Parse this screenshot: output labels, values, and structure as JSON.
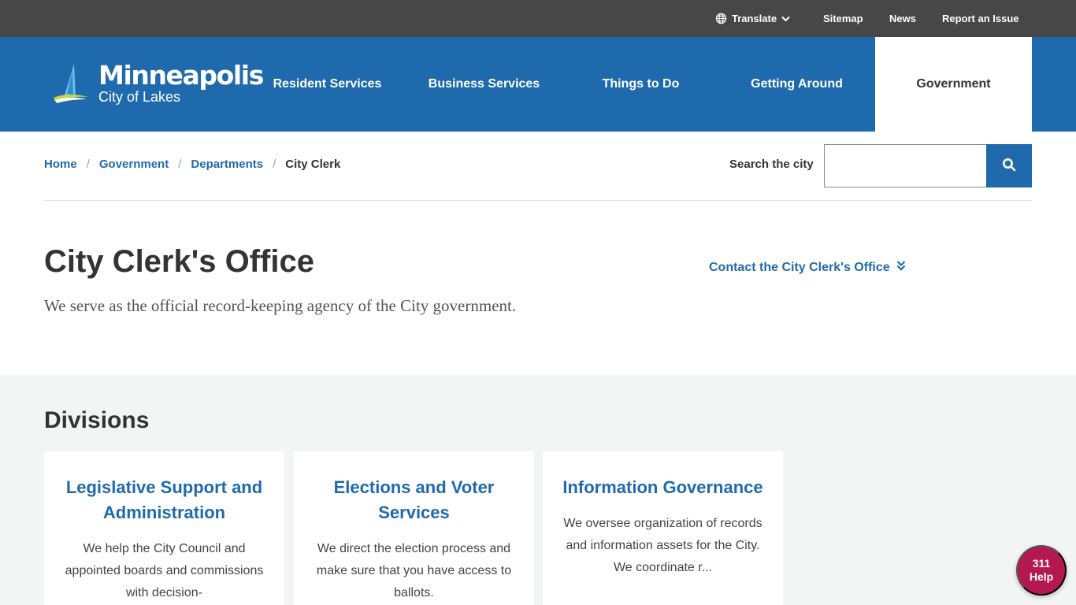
{
  "utility": {
    "translate_label": "Translate",
    "sitemap_label": "Sitemap",
    "news_label": "News",
    "report_label": "Report an Issue"
  },
  "logo": {
    "name": "Minneapolis",
    "tagline": "City of Lakes"
  },
  "nav": {
    "items": [
      {
        "label": "Resident Services"
      },
      {
        "label": "Business Services"
      },
      {
        "label": "Things to Do"
      },
      {
        "label": "Getting Around"
      },
      {
        "label": "Government"
      }
    ],
    "active": "Government"
  },
  "breadcrumb": {
    "items": [
      {
        "label": "Home"
      },
      {
        "label": "Government"
      },
      {
        "label": "Departments"
      }
    ],
    "separator": "/",
    "current": "City Clerk"
  },
  "search": {
    "label": "Search the city",
    "value": ""
  },
  "hero": {
    "title": "City Clerk's Office",
    "subtitle": "We serve as the official record-keeping agency of the City government.",
    "contact_link": "Contact the City Clerk's Office"
  },
  "divisions": {
    "heading": "Divisions",
    "cards": [
      {
        "title": "Legislative Support and Administration",
        "text": "We help the City Council and appointed boards and commissions with decision-"
      },
      {
        "title": "Elections and Voter Services",
        "text": "We direct the election process and make sure that you have access to ballots."
      },
      {
        "title": "Information Governance",
        "text": "We oversee organization of records and information assets for the City. We coordinate r..."
      }
    ]
  },
  "help": {
    "number": "311",
    "label": "Help"
  },
  "colors": {
    "brand_blue": "#1f6aad",
    "utility_bar": "#474747",
    "help_button": "#b5184f",
    "section_bg": "#f3f4f4"
  },
  "icons": [
    "globe-icon",
    "chevron-down-icon",
    "sailboat-logo-icon",
    "search-icon",
    "double-chevron-down-icon"
  ]
}
